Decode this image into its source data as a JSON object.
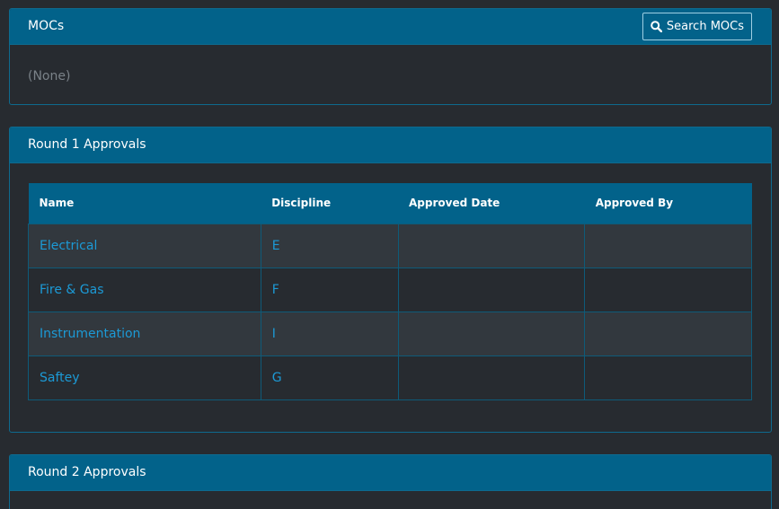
{
  "mocs_panel": {
    "title": "MOCs",
    "search_button_label": "Search MOCs",
    "search_icon": "search-icon",
    "empty_text": "(None)"
  },
  "round1_panel": {
    "title": "Round 1 Approvals",
    "columns": [
      "Name",
      "Discipline",
      "Approved Date",
      "Approved By"
    ],
    "rows": [
      {
        "name": "Electrical",
        "discipline": "E",
        "approved_date": "",
        "approved_by": ""
      },
      {
        "name": "Fire & Gas",
        "discipline": "F",
        "approved_date": "",
        "approved_by": ""
      },
      {
        "name": "Instrumentation",
        "discipline": "I",
        "approved_date": "",
        "approved_by": ""
      },
      {
        "name": "Saftey",
        "discipline": "G",
        "approved_date": "",
        "approved_by": ""
      }
    ]
  },
  "round2_panel": {
    "title": "Round 2 Approvals"
  },
  "colors": {
    "background": "#272b30",
    "header": "#02628a",
    "link": "#1c9ad6"
  }
}
